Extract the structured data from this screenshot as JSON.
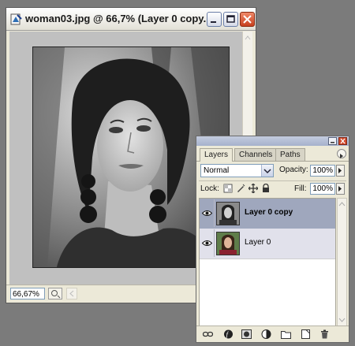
{
  "document": {
    "title": "woman03.jpg @ 66,7% (Layer 0 copy...",
    "zoom": "66,67%"
  },
  "layers_panel": {
    "tabs": [
      {
        "label": "Layers",
        "active": true
      },
      {
        "label": "Channels",
        "active": false
      },
      {
        "label": "Paths",
        "active": false
      }
    ],
    "blend_mode": "Normal",
    "opacity_label": "Opacity:",
    "opacity_value": "100%",
    "lock_label": "Lock:",
    "fill_label": "Fill:",
    "fill_value": "100%",
    "layers": [
      {
        "name": "Layer 0 copy",
        "selected": true,
        "visible": true
      },
      {
        "name": "Layer 0",
        "selected": false,
        "visible": true
      }
    ],
    "bottom_icons": [
      "link-layers-icon",
      "layer-style-icon",
      "add-mask-icon",
      "adjustment-layer-icon",
      "new-group-icon",
      "new-layer-icon",
      "delete-layer-icon"
    ]
  },
  "colors": {
    "desktop": "#7b7b7b",
    "selected_layer": "#9fa7bd",
    "close_button": "#d24a2c"
  }
}
